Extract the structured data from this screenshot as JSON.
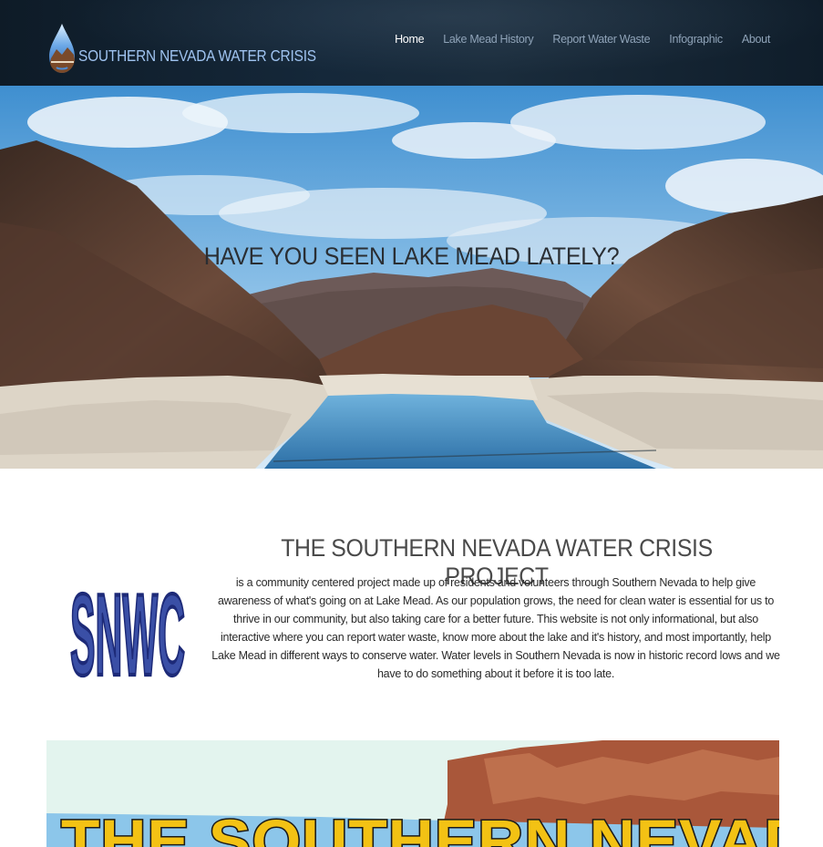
{
  "header": {
    "logo_text": "SOUTHERN NEVADA WATER CRISIS",
    "nav": [
      {
        "label": "Home",
        "active": true
      },
      {
        "label": "Lake Mead History",
        "active": false
      },
      {
        "label": "Report Water Waste",
        "active": false
      },
      {
        "label": "Infographic",
        "active": false
      },
      {
        "label": "About",
        "active": false
      }
    ]
  },
  "hero": {
    "title": "HAVE YOU SEEN LAKE MEAD LATELY?",
    "image": "lake-mead-canyon-photo"
  },
  "project": {
    "logo_text": "SNWC",
    "title": "THE SOUTHERN NEVADA WATER CRISIS PROJECT",
    "body": "is a community centered project made up of residents and volunteers through Southern Nevada to help give awareness of what's going on at Lake Mead. As our population grows, the need for clean water is essential for us to thrive in our community, but also taking care for a better future. This website is not only informational, but also interactive where you can report water waste, know more about the lake and it's history, and most importantly, help Lake Mead in different ways to conserve water. Water levels in Southern Nevada is now in historic record lows and we have to do something about it before it is too late."
  },
  "infographic": {
    "title_visible": "THE SOUTHERN NEVADA"
  },
  "colors": {
    "header_bg": "#13212f",
    "nav_text": "#8fa3b8",
    "nav_active": "#ffffff",
    "logo_text": "#9fc3f0",
    "snwc_fill": "#3a4fa6",
    "infographic_yellow": "#f3c214"
  }
}
